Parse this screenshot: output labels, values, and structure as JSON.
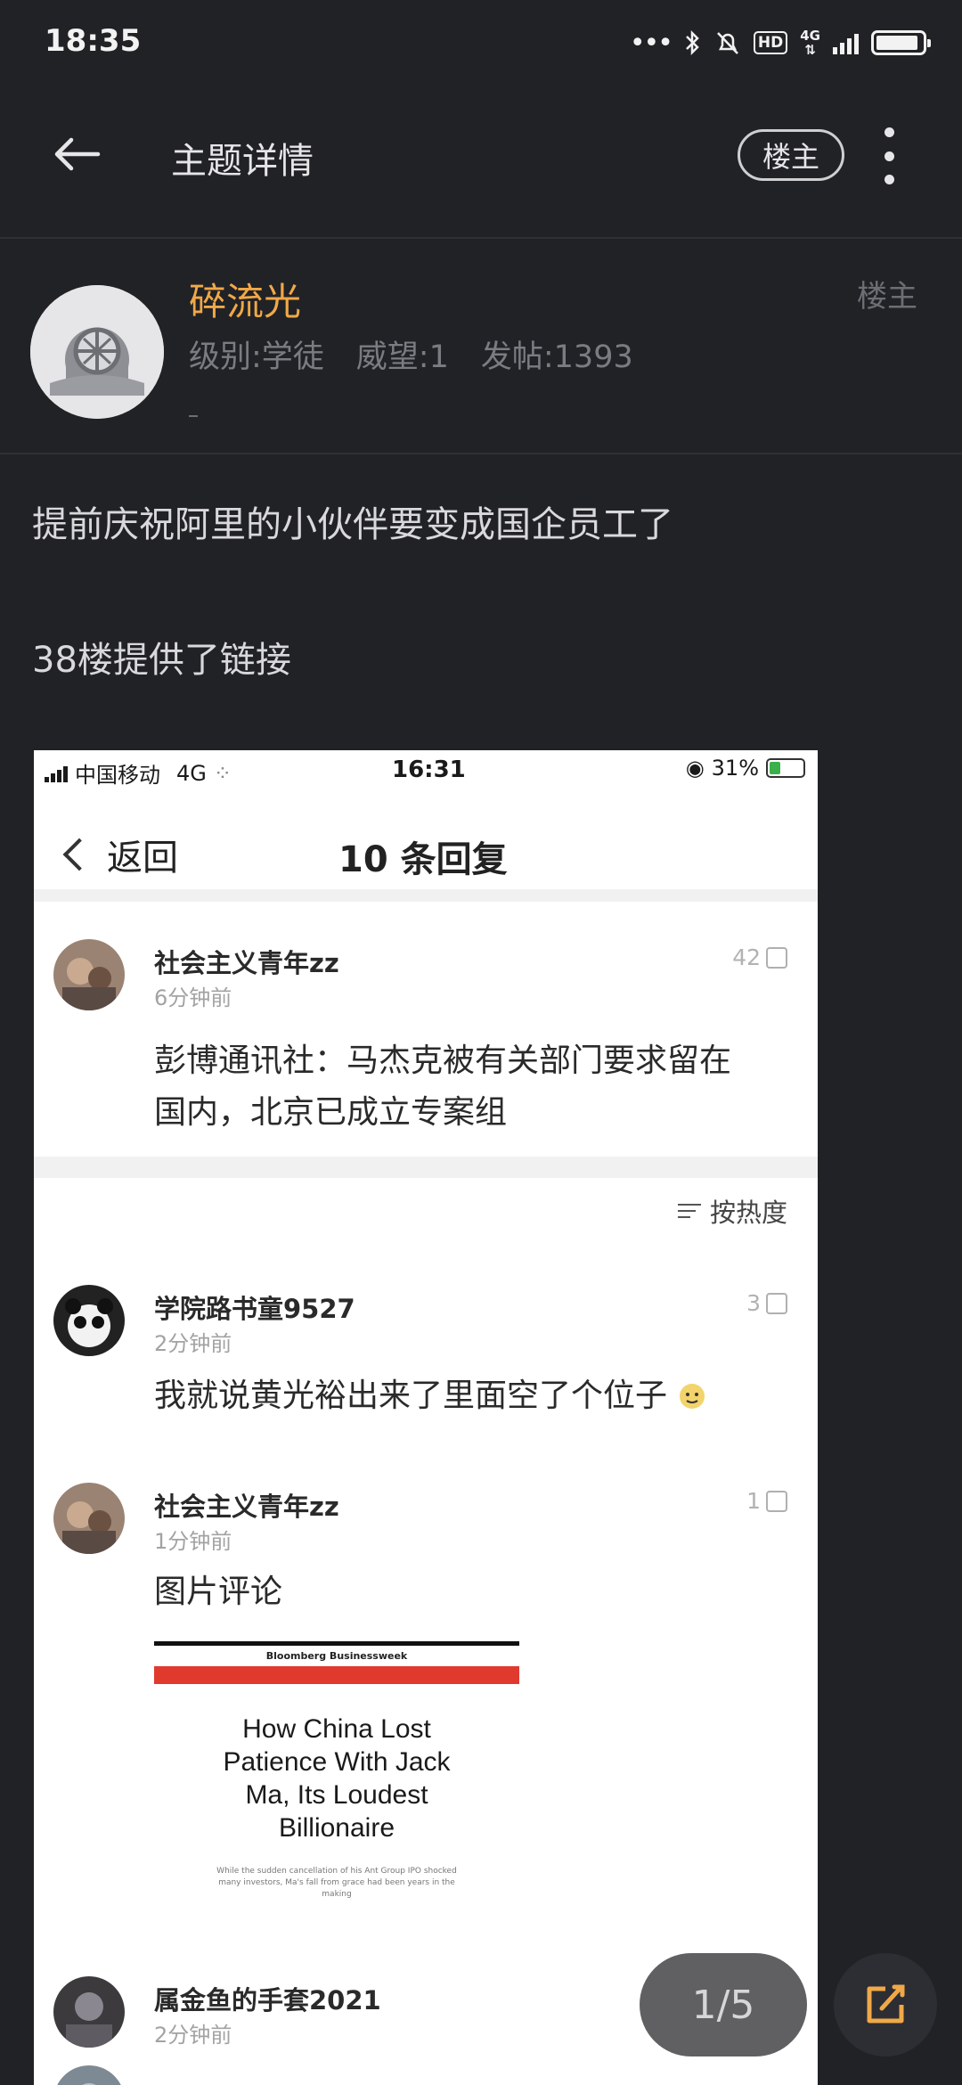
{
  "status_bar": {
    "time": "18:35",
    "network": "4G"
  },
  "header": {
    "title": "主题详情",
    "owner_filter": "楼主"
  },
  "author": {
    "name": "碎流光",
    "level": "级别:学徒",
    "reputation": "威望:1",
    "posts": "发帖:1393",
    "mark": "楼主"
  },
  "post": {
    "lines": [
      "提前庆祝阿里的小伙伴要变成国企员工了",
      "38楼提供了链接"
    ]
  },
  "embedded_screenshot": {
    "carrier": "中国移动",
    "network": "4G",
    "time": "16:31",
    "battery": "31%",
    "back_label": "返回",
    "title": "10 条回复",
    "sort_label": "按热度",
    "comments": [
      {
        "user": "社会主义青年zz",
        "time": "6分钟前",
        "likes": "42",
        "text": [
          "彭博通讯社：马杰克被有关部门要求留在",
          "国内，北京已成立专案组"
        ]
      },
      {
        "user": "学院路书童9527",
        "time": "2分钟前",
        "likes": "3",
        "text": [
          "我就说黄光裕出来了里面空了个位子"
        ]
      },
      {
        "user": "社会主义青年zz",
        "time": "1分钟前",
        "likes": "1",
        "text": [
          "图片评论"
        ]
      },
      {
        "user": "属金鱼的手套2021",
        "time": "2分钟前",
        "likes": "",
        "text": []
      }
    ],
    "image_card": {
      "brand": "Bloomberg Businessweek",
      "headline": [
        "How China Lost",
        "Patience With Jack",
        "Ma, Its Loudest",
        "Billionaire"
      ],
      "subtext": [
        "While the sudden cancellation of his Ant Group IPO shocked",
        "many investors, Ma's fall from grace had been years in the",
        "making"
      ]
    }
  },
  "pager": {
    "label": "1/5"
  },
  "colors": {
    "background": "#212226",
    "author_name": "#f0a848",
    "accent": "#f0a848"
  }
}
